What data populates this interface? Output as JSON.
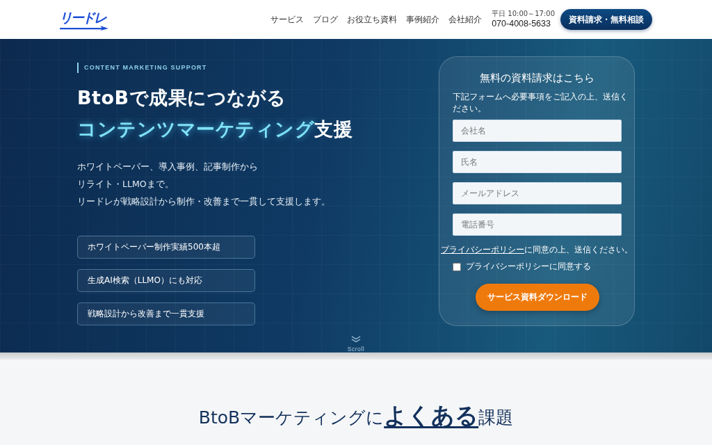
{
  "header": {
    "logo": "リードレ",
    "nav": [
      "サービス",
      "ブログ",
      "お役立ち資料",
      "事例紹介",
      "会社紹介"
    ],
    "hours": "平日 10:00～17:00",
    "phone": "070-4008-5633",
    "cta": "資料請求・無料相談"
  },
  "hero": {
    "eyebrow": "CONTENT MARKETING SUPPORT",
    "headline": {
      "lines": [
        [
          {
            "text": "BtoBで成果につながる",
            "highlight": false
          }
        ],
        [
          {
            "text": "コンテンツマーケティング",
            "highlight": true
          },
          {
            "text": "支援",
            "highlight": false
          }
        ]
      ]
    },
    "description": [
      "ホワイトペーパー、導入事例、記事制作から",
      "リライト・LLMOまで。",
      "リードレが戦略設計から制作・改善まで一貫して支援します。"
    ],
    "features": [
      "ホワイトペーパー制作実績500本超",
      "生成AI検索（LLMO）にも対応",
      "戦略設計から改善まで一貫支援"
    ],
    "scroll": "Scroll"
  },
  "form": {
    "title": "無料の資料請求はこちら",
    "description": "下記フォームへ必要事項をご記入の上、送信ください。",
    "fields": [
      {
        "placeholder": "会社名"
      },
      {
        "placeholder": "氏名"
      },
      {
        "placeholder": "メールアドレス"
      },
      {
        "placeholder": "電話番号"
      }
    ],
    "consent": {
      "link": "プライバシーポリシー",
      "text": "に同意の上、送信ください。"
    },
    "checkbox": {
      "label": "プライバシーポリシーに同意する",
      "checked": false
    },
    "submit": "サービス資料ダウンロード"
  },
  "section": {
    "heading": "BtoBマーケティングに**よくある**課題"
  }
}
